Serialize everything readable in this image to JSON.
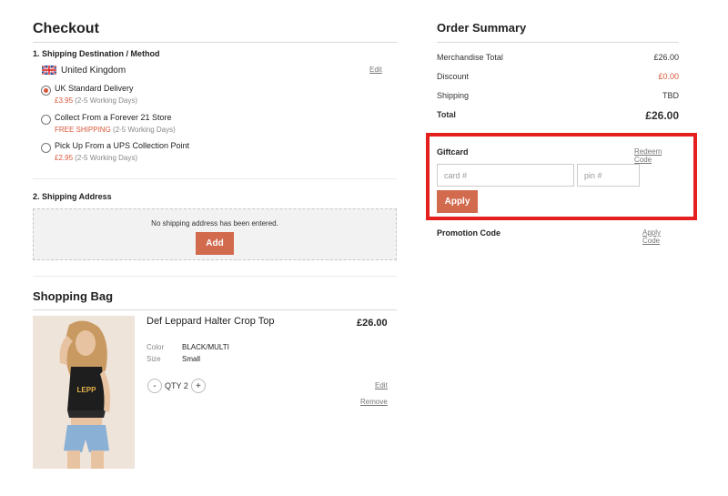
{
  "checkout": {
    "title": "Checkout",
    "shipping_section_title": "1. Shipping Destination / Method",
    "country": "United Kingdom",
    "country_edit": "Edit",
    "options": [
      {
        "name": "UK Standard Delivery",
        "price": "£3.95",
        "days": "(2-5 Working Days)",
        "selected": true
      },
      {
        "name": "Collect From a Forever 21 Store",
        "price": "FREE SHIPPING",
        "days": "(2-5 Working Days)",
        "selected": false
      },
      {
        "name": "Pick Up From a UPS Collection Point",
        "price": "£2.95",
        "days": "(2-5 Working Days)",
        "selected": false
      }
    ],
    "address_section_title": "2. Shipping Address",
    "address_empty": "No shipping address has been entered.",
    "address_add": "Add"
  },
  "bag": {
    "title": "Shopping Bag",
    "item": {
      "name": "Def Leppard Halter Crop Top",
      "price": "£26.00",
      "color_label": "Color",
      "color": "BLACK/MULTI",
      "size_label": "Size",
      "size": "Small",
      "qty_label": "QTY 2",
      "minus": "-",
      "plus": "+",
      "edit": "Edit",
      "remove": "Remove"
    }
  },
  "summary": {
    "title": "Order Summary",
    "merch_label": "Merchandise Total",
    "merch_value": "£26.00",
    "discount_label": "Discount",
    "discount_value": "£0.00",
    "shipping_label": "Shipping",
    "shipping_value": "TBD",
    "total_label": "Total",
    "total_value": "£26.00",
    "giftcard_label": "Giftcard",
    "redeem_link": "Redeem Code",
    "card_placeholder": "card #",
    "pin_placeholder": "pin #",
    "apply_button": "Apply",
    "promo_label": "Promotion Code",
    "promo_link": "Apply Code"
  },
  "colors": {
    "accent": "#d26a4e",
    "price_red": "#d8573a",
    "highlight": "#e4201f"
  }
}
